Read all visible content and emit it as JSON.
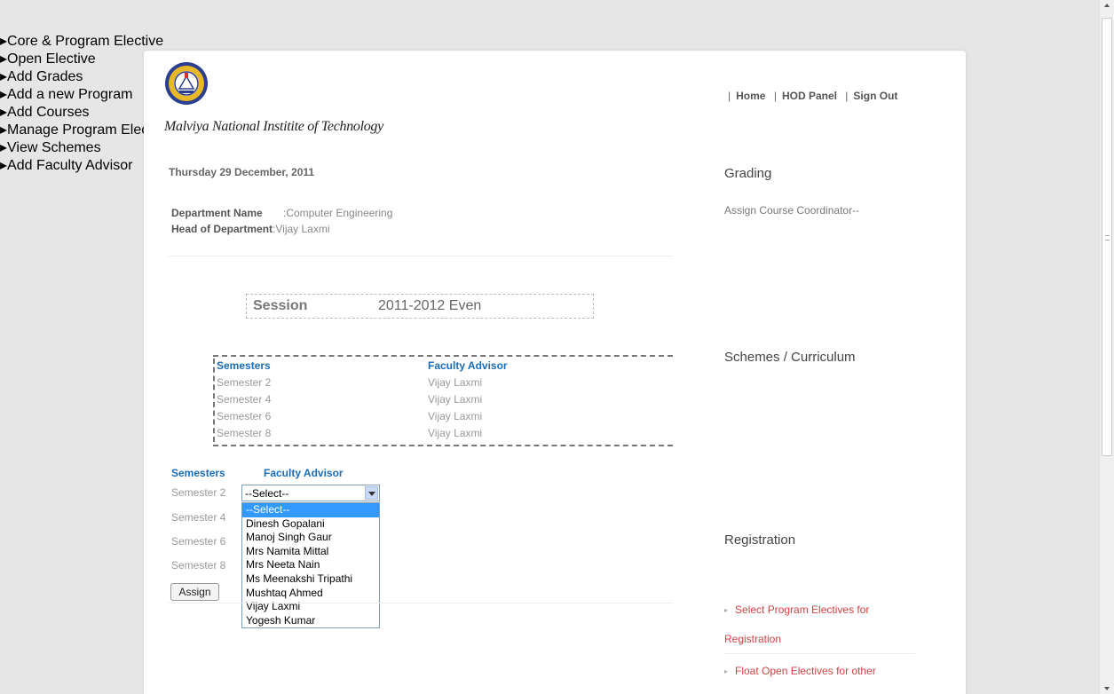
{
  "header": {
    "institute_name": "Malviya National Institite of Technology",
    "nav": [
      {
        "label": "Home"
      },
      {
        "label": "HOD Panel"
      },
      {
        "label": "Sign Out"
      }
    ]
  },
  "main": {
    "date": "Thursday 29 December, 2011",
    "department_label": "Department Name",
    "department_value": ":Computer Engineering",
    "hod_label": "Head of Department",
    "hod_value": ":Vijay Laxmi",
    "session_label": "Session",
    "session_value": "2011-2012 Even",
    "current_table": {
      "col1": "Semesters",
      "col2": "Faculty Advisor",
      "rows": [
        {
          "semester": "Semester 2",
          "advisor": "Vijay Laxmi"
        },
        {
          "semester": "Semester 4",
          "advisor": "Vijay Laxmi"
        },
        {
          "semester": "Semester 6",
          "advisor": "Vijay Laxmi"
        },
        {
          "semester": "Semester 8",
          "advisor": "Vijay Laxmi"
        }
      ]
    },
    "assign_form": {
      "col1": "Semesters",
      "col2": "Faculty Advisor",
      "semesters": [
        "Semester 2",
        "Semester 4",
        "Semester 6",
        "Semester 8"
      ],
      "select_value": "--Select--",
      "options": [
        "--Select--",
        "Dinesh Gopalani",
        "Manoj Singh Gaur",
        "Mrs Namita Mittal",
        "Mrs Neeta Nain",
        "Ms Meenakshi Tripathi",
        "Mushtaq Ahmed",
        "Vijay Laxmi",
        "Yogesh Kumar"
      ],
      "assign_label": "Assign"
    }
  },
  "sidebar": {
    "grading_title": "Grading",
    "grading_note": "Assign Course Coordinator--",
    "grading_items": [
      "Core & Program Elective",
      "Open Elective",
      "Add Grades"
    ],
    "schemes_title": "Schemes / Curriculum",
    "schemes_items": [
      "Add a new Program",
      "Add Courses",
      "Manage Program Electives",
      "View Schemes"
    ],
    "registration_title": "Registration",
    "registration_items": [
      "Add Faculty Advisor",
      "Select Program Electives for",
      "Registration",
      "Float Open Electives for other"
    ]
  },
  "colors": {
    "link_red": "#cc4444",
    "header_blue": "#1a6db8",
    "select_highlight": "#3399ff"
  }
}
